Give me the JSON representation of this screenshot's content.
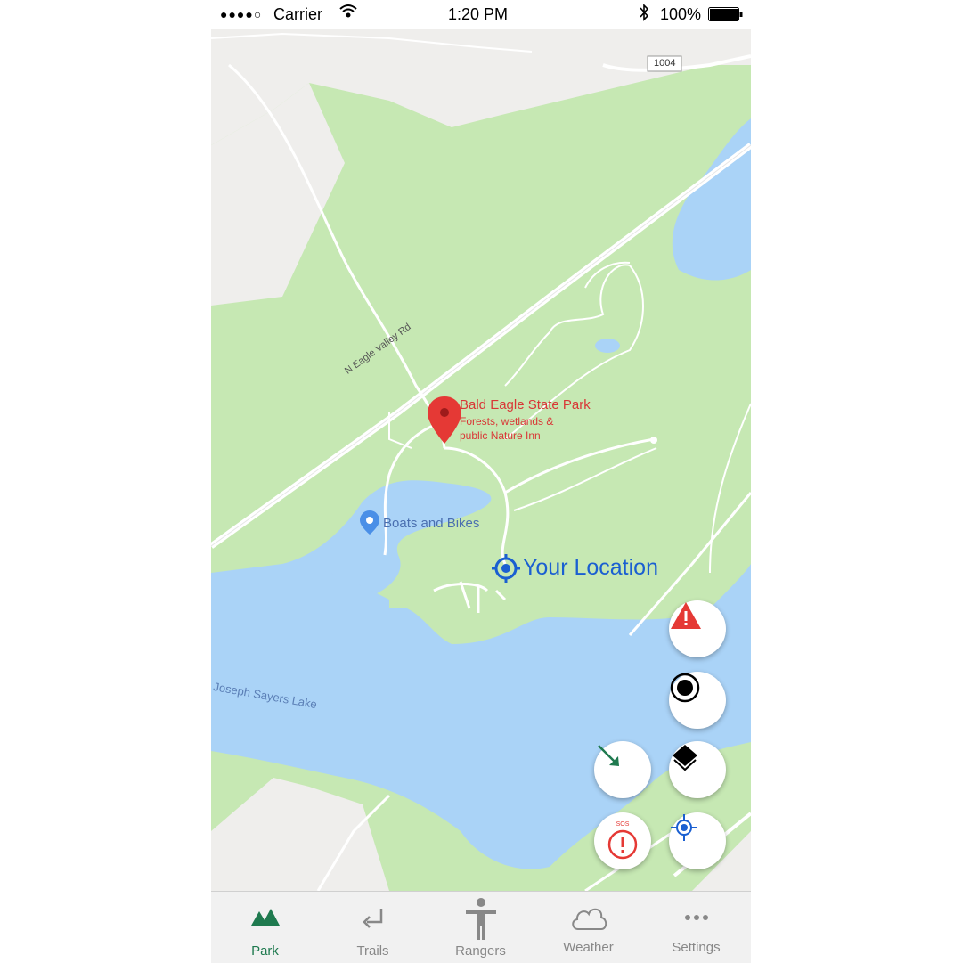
{
  "status_bar": {
    "signal": "●●●●○",
    "carrier": "Carrier",
    "time": "1:20 PM",
    "battery": "100%"
  },
  "map": {
    "road_badge": "1004",
    "road_label": "N Eagle Valley Rd",
    "poi_title": "Bald Eagle State Park",
    "poi_line1": "Forests, wetlands &",
    "poi_line2": "public Nature Inn",
    "boats_label": "Boats and Bikes",
    "lake_label": "Joseph Sayers Lake",
    "your_location": "Your Location",
    "colors": {
      "park": "#c6e8b3",
      "water": "#aad3f7",
      "land": "#efeeec",
      "road": "#ffffff",
      "marker": "#e53935"
    }
  },
  "actions": {
    "hazard": "hazard-icon",
    "record": "record-icon",
    "direction": "arrow-icon",
    "layers": "layers-icon",
    "sos_text": "SOS",
    "center": "crosshair-icon"
  },
  "tabs": [
    {
      "label": "Park",
      "icon": "mountain-icon",
      "active": true
    },
    {
      "label": "Trails",
      "icon": "return-arrow-icon"
    },
    {
      "label": "Rangers",
      "icon": "person-icon"
    },
    {
      "label": "Weather",
      "icon": "cloud-icon"
    },
    {
      "label": "Settings",
      "icon": "more-icon"
    }
  ],
  "accent": "#1f7a4f"
}
